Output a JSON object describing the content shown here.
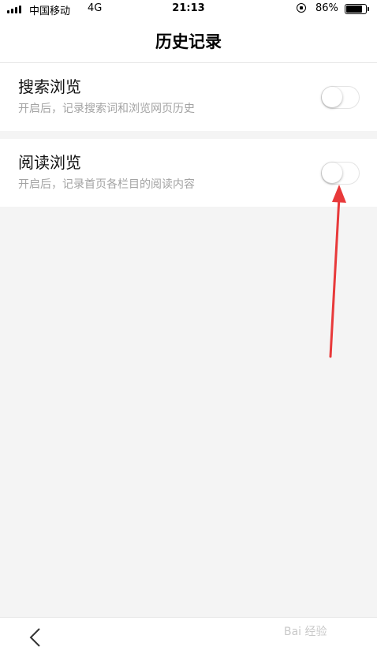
{
  "status_bar": {
    "carrier": "中国移动",
    "network": "4G",
    "time": "21:13",
    "battery_percent": "86%",
    "battery_level": 0.86,
    "icons": [
      "signal-icon",
      "rotation-lock-icon",
      "battery-icon"
    ]
  },
  "nav": {
    "title": "历史记录"
  },
  "settings": [
    {
      "title": "搜索浏览",
      "subtitle": "开启后，记录搜索词和浏览网页历史",
      "enabled": false
    },
    {
      "title": "阅读浏览",
      "subtitle": "开启后，记录首页各栏目的阅读内容",
      "enabled": false
    }
  ],
  "toolbar": {
    "back_icon": "chevron-left-icon"
  },
  "colors": {
    "background": "#f4f4f4",
    "arrow": "#e8393a",
    "subtitle": "#a3a3a3"
  },
  "watermark": "Bai 经验"
}
